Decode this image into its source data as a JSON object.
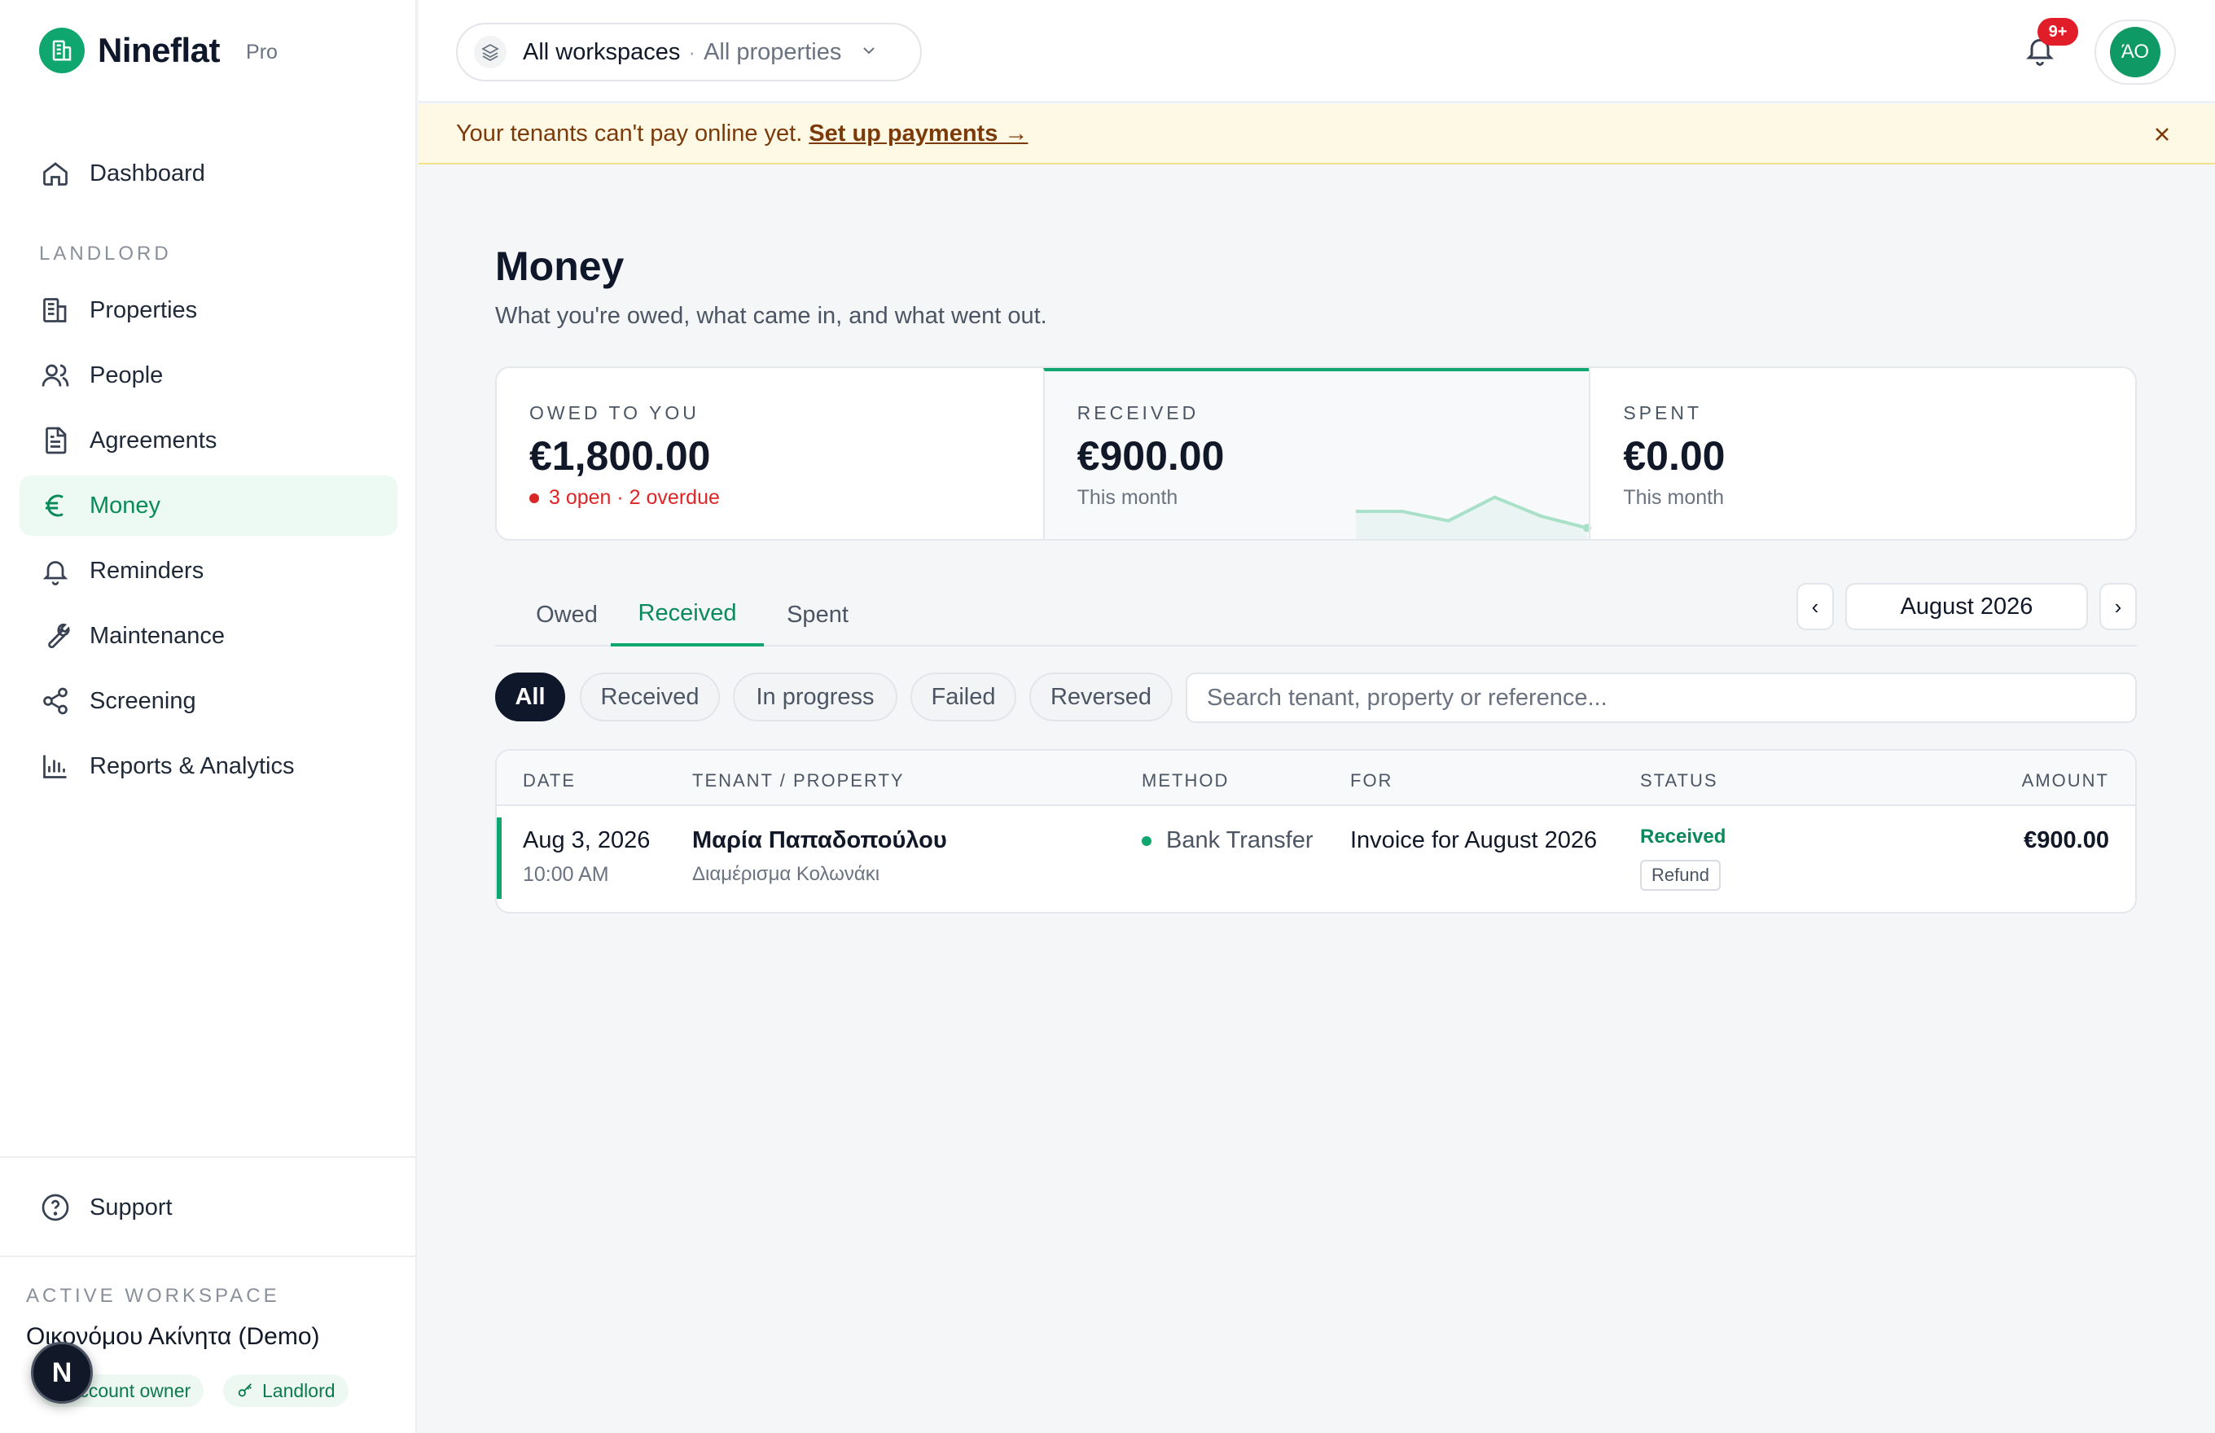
{
  "brand": {
    "name": "Nineflat",
    "tier": "Pro"
  },
  "sidebar": {
    "dashboard": "Dashboard",
    "section_label": "LANDLORD",
    "items": [
      {
        "label": "Properties",
        "icon": "building-icon"
      },
      {
        "label": "People",
        "icon": "users-icon"
      },
      {
        "label": "Agreements",
        "icon": "document-icon"
      },
      {
        "label": "Money",
        "icon": "euro-icon",
        "active": true
      },
      {
        "label": "Reminders",
        "icon": "bell-icon"
      },
      {
        "label": "Maintenance",
        "icon": "wrench-icon"
      },
      {
        "label": "Screening",
        "icon": "share-icon"
      },
      {
        "label": "Reports & Analytics",
        "icon": "bar-chart-icon"
      }
    ],
    "support": "Support",
    "workspace_label": "ACTIVE WORKSPACE",
    "workspace_name": "Οικονόμου Ακίνητα (Demo)",
    "badges": [
      "Account owner",
      "Landlord"
    ],
    "fab_letter": "N"
  },
  "header": {
    "workspace": "All workspaces",
    "separator": "·",
    "property": "All properties",
    "notif_count": "9+",
    "avatar_initials": "ΆΟ"
  },
  "banner": {
    "text": "Your tenants can't pay online yet.",
    "link": "Set up payments →"
  },
  "page": {
    "title": "Money",
    "subtitle": "What you're owed, what came in, and what went out."
  },
  "kpis": {
    "owed": {
      "label": "OWED TO YOU",
      "value": "€1,800.00",
      "sub": "3 open · 2 overdue"
    },
    "received": {
      "label": "RECEIVED",
      "value": "€900.00",
      "sub": "This month",
      "sparkline": [
        0.55,
        0.55,
        0.35,
        0.85,
        0.45,
        0.2
      ]
    },
    "spent": {
      "label": "SPENT",
      "value": "€0.00",
      "sub": "This month"
    }
  },
  "tabs": [
    "Owed",
    "Received",
    "Spent"
  ],
  "active_tab": "Received",
  "month": {
    "label": "August 2026",
    "prev": "‹",
    "next": "›"
  },
  "filters": [
    "All",
    "Received",
    "In progress",
    "Failed",
    "Reversed"
  ],
  "search": {
    "placeholder": "Search tenant, property or reference..."
  },
  "table": {
    "headers": {
      "date": "DATE",
      "tenant": "TENANT / PROPERTY",
      "method": "METHOD",
      "for": "FOR",
      "status": "STATUS",
      "amount": "AMOUNT"
    },
    "rows": [
      {
        "date": "Aug 3, 2026",
        "time": "10:00 AM",
        "tenant": "Μαρία Παπαδοπούλου",
        "property": "Διαμέρισμα Κολωνάκι",
        "method": "Bank Transfer",
        "for": "Invoice for August 2026",
        "status": "Received",
        "action": "Refund",
        "amount": "€900.00"
      }
    ]
  },
  "colors": {
    "accent": "#10a66f",
    "danger": "#dc2626",
    "banner_bg": "#fef9e4"
  }
}
